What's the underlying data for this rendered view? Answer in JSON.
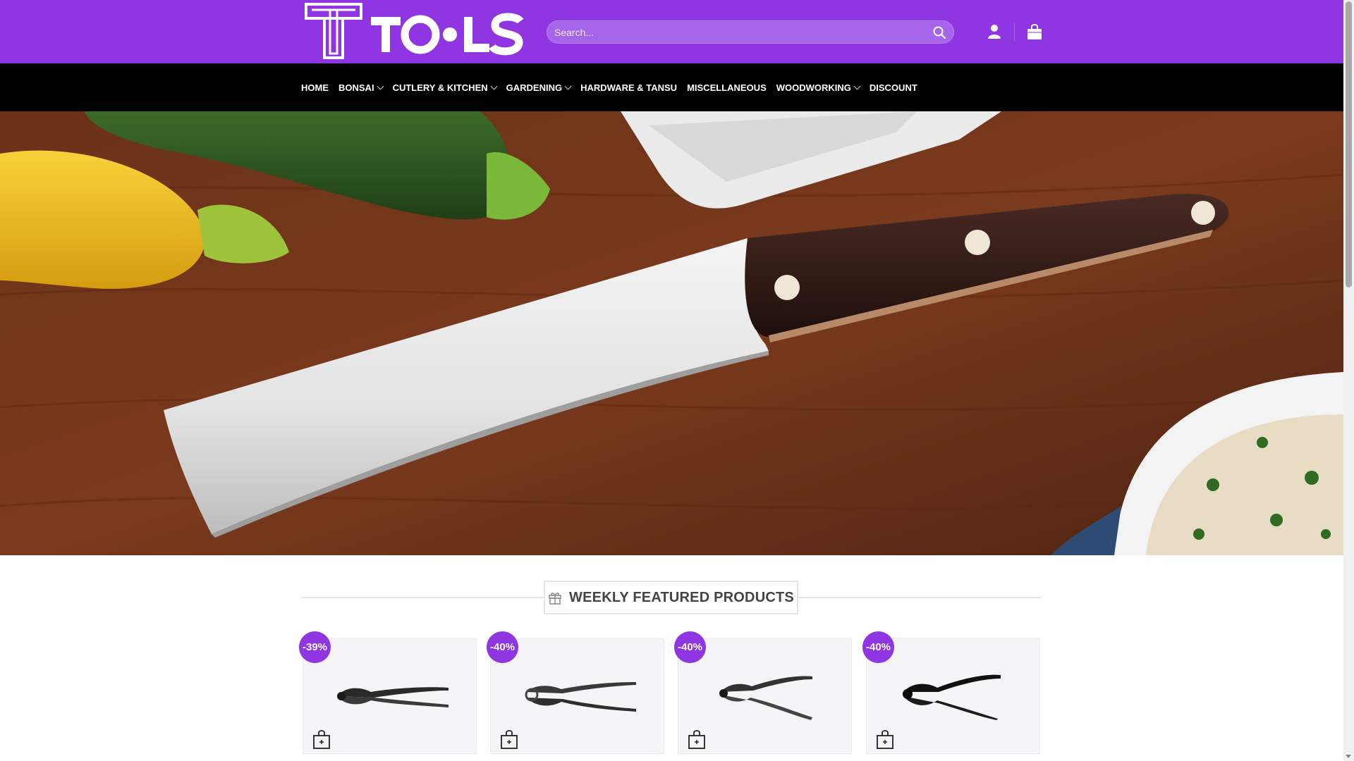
{
  "brand": {
    "logo_text": "TOOLS"
  },
  "search": {
    "placeholder": "Search..."
  },
  "nav": {
    "items": [
      {
        "label": "HOME",
        "dropdown": false
      },
      {
        "label": "BONSAI",
        "dropdown": true
      },
      {
        "label": "CUTLERY & KITCHEN",
        "dropdown": true
      },
      {
        "label": "GARDENING",
        "dropdown": true
      },
      {
        "label": "HARDWARE & TANSU",
        "dropdown": false
      },
      {
        "label": "MISCELLANEOUS",
        "dropdown": false
      },
      {
        "label": "WOODWORKING",
        "dropdown": true
      },
      {
        "label": "DISCOUNT",
        "dropdown": false
      }
    ]
  },
  "section": {
    "title": "WEEKLY FEATURED PRODUCTS"
  },
  "products": [
    {
      "discount": "-39%"
    },
    {
      "discount": "-40%"
    },
    {
      "discount": "-40%"
    },
    {
      "discount": "-40%"
    }
  ],
  "colors": {
    "brand_purple": "#8f35e2",
    "nav_black": "#000000"
  },
  "icons": {
    "search": "search-icon",
    "account": "user-icon",
    "cart": "shopping-bag-icon",
    "section": "gift-icon",
    "add_to_cart": "add-to-cart-bag-icon"
  }
}
